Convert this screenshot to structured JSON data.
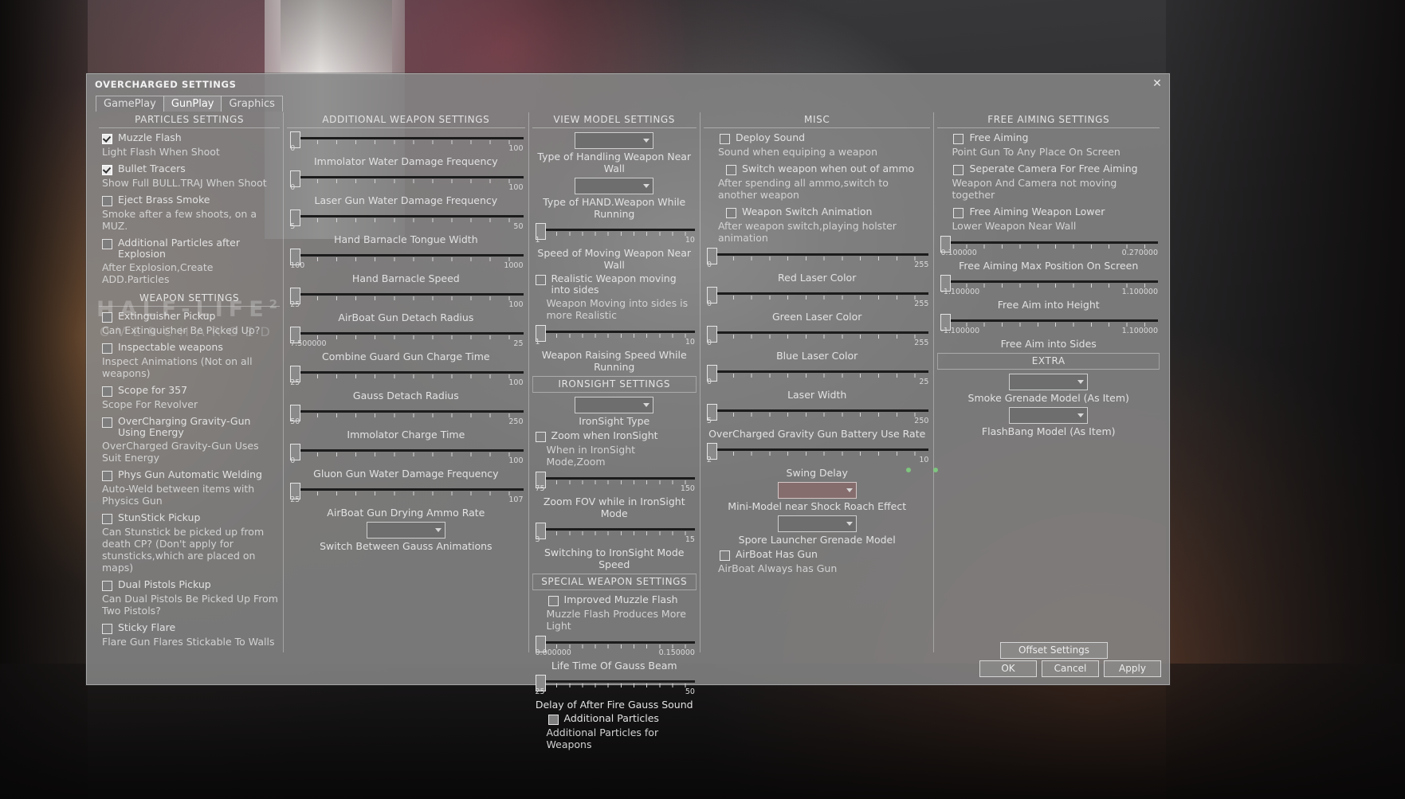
{
  "window": {
    "title": "OVERCHARGED SETTINGS",
    "close_icon": "close-icon"
  },
  "tabs": [
    {
      "label": "GamePlay",
      "active": false
    },
    {
      "label": "GunPlay",
      "active": true
    },
    {
      "label": "Graphics",
      "active": false
    }
  ],
  "watermark": {
    "line1": "HALF-LIFE",
    "sup": "2",
    "line2": "OVERCHARGED"
  },
  "columns": {
    "particles": {
      "header": "PARTICLES SETTINGS",
      "items": [
        {
          "label": "Muzzle Flash",
          "checked": true,
          "desc": "Light Flash When Shoot"
        },
        {
          "label": "Bullet Tracers",
          "checked": true,
          "desc": "Show Full BULL.TRAJ When Shoot"
        },
        {
          "label": "Eject Brass Smoke",
          "checked": false,
          "desc": "Smoke after a few shoots, on a MUZ."
        },
        {
          "label": "Additional Particles after Explosion",
          "checked": false,
          "desc": "After Explosion,Create ADD.Particles"
        }
      ],
      "header2": "WEAPON SETTINGS",
      "items2": [
        {
          "label": "Extinguisher Pickup",
          "checked": false,
          "desc": "Can Extinguisher Be Picked Up?"
        },
        {
          "label": "Inspectable weapons",
          "checked": false,
          "desc": "Inspect Animations (Not on all weapons)"
        },
        {
          "label": "Scope for 357",
          "checked": false,
          "desc": "Scope For Revolver"
        },
        {
          "label": "OverCharging Gravity-Gun Using Energy",
          "checked": false,
          "desc": "OverCharged Gravity-Gun Uses Suit Energy"
        },
        {
          "label": "Phys Gun Automatic Welding",
          "checked": false,
          "desc": "Auto-Weld between items with Physics Gun"
        },
        {
          "label": "StunStick Pickup",
          "checked": false,
          "desc": "Can Stunstick be picked up from death CP? (Don't apply for stunsticks,which are placed on maps)"
        },
        {
          "label": "Dual Pistols Pickup",
          "checked": false,
          "desc": "Can Dual Pistols Be Picked Up From Two Pistols?"
        },
        {
          "label": "Sticky Flare",
          "checked": false,
          "desc": "Flare Gun Flares Stickable To Walls"
        }
      ]
    },
    "additional_weapon": {
      "header": "ADDITIONAL WEAPON SETTINGS",
      "sliders": [
        {
          "label": "Immolator Water Damage Frequency",
          "min": "0",
          "max": "100",
          "pos": 0
        },
        {
          "label": "Laser Gun Water Damage Frequency",
          "min": "0",
          "max": "100",
          "pos": 0
        },
        {
          "label": "Hand Barnacle Tongue Width",
          "min": "5",
          "max": "50",
          "pos": 0
        },
        {
          "label": "Hand Barnacle Speed",
          "min": "100",
          "max": "1000",
          "pos": 0
        },
        {
          "label": "AirBoat Gun Detach Radius",
          "min": "25",
          "max": "100",
          "pos": 0
        },
        {
          "label": "Combine Guard Gun Charge Time",
          "min": "7.500000",
          "max": "25",
          "pos": 0
        },
        {
          "label": "Gauss Detach Radius",
          "min": "25",
          "max": "100",
          "pos": 0
        },
        {
          "label": "Immolator Charge Time",
          "min": "50",
          "max": "250",
          "pos": 0
        },
        {
          "label": "Gluon Gun Water Damage Frequency",
          "min": "0",
          "max": "100",
          "pos": 0
        },
        {
          "label": "AirBoat Gun Drying Ammo Rate",
          "min": "25",
          "max": "107",
          "pos": 0
        }
      ],
      "combo_label": "Switch Between Gauss Animations",
      "combo_value": ""
    },
    "view_model": {
      "header": "VIEW MODEL SETTINGS",
      "combo1_label": "Type of Handling Weapon Near Wall",
      "combo1_value": "",
      "combo2_label": "Type of HAND.Weapon While Running",
      "combo2_value": "",
      "slider1": {
        "label": "Speed of Moving Weapon Near Wall",
        "min": "1",
        "max": "10",
        "pos": 0
      },
      "check1": {
        "label": "Realistic Weapon moving into sides",
        "checked": false,
        "desc": "Weapon Moving into sides is more Realistic"
      },
      "slider2": {
        "label": "Weapon Raising Speed While Running",
        "min": "1",
        "max": "10",
        "pos": 0
      },
      "ironsight_header": "IRONSIGHT SETTINGS",
      "iron_combo_label": "IronSight Type",
      "iron_combo_value": "",
      "iron_check": {
        "label": "Zoom when IronSight",
        "checked": false,
        "desc": "When in IronSight Mode,Zoom"
      },
      "iron_slider1": {
        "label": "Zoom FOV while in IronSight Mode",
        "min": "75",
        "max": "150",
        "pos": 0
      },
      "iron_slider2": {
        "label": "Switching to IronSight Mode Speed",
        "min": "3",
        "max": "15",
        "pos": 0
      },
      "special_header": "SPECIAL WEAPON SETTINGS",
      "special_check1": {
        "label": "Improved Muzzle Flash",
        "checked": false,
        "desc": "Muzzle Flash Produces More Light"
      },
      "special_slider1": {
        "label": "Life Time Of Gauss Beam",
        "min": "0.000000",
        "max": "0.150000",
        "pos": 0
      },
      "special_slider2": {
        "label": "Delay of After Fire Gauss Sound",
        "min": "25",
        "max": "50",
        "pos": 0
      },
      "special_check2": {
        "label": "Additional Particles",
        "checked": false,
        "desc": "Additional Particles for Weapons"
      }
    },
    "misc": {
      "header": "MISC",
      "checks": [
        {
          "label": "Deploy Sound",
          "checked": false,
          "desc": "Sound when equiping a weapon",
          "indent": 0
        },
        {
          "label": "Switch weapon when out of ammo",
          "checked": false,
          "desc": "After spending all ammo,switch to another weapon",
          "indent": 1
        },
        {
          "label": "Weapon Switch Animation",
          "checked": false,
          "desc": "After weapon switch,playing holster animation",
          "indent": 1
        }
      ],
      "sliders": [
        {
          "label": "Red Laser Color",
          "min": "0",
          "max": "255",
          "pos": 0
        },
        {
          "label": "Green Laser Color",
          "min": "0",
          "max": "255",
          "pos": 0
        },
        {
          "label": "Blue Laser Color",
          "min": "0",
          "max": "255",
          "pos": 0
        },
        {
          "label": "Laser Width",
          "min": "0",
          "max": "25",
          "pos": 0
        },
        {
          "label": "OverCharged Gravity Gun Battery Use Rate",
          "min": "5",
          "max": "250",
          "pos": 0
        },
        {
          "label": "Swing Delay",
          "min": "2",
          "max": "10",
          "pos": 0
        }
      ],
      "combo1_label": "Mini-Model near Shock Roach Effect",
      "combo1_value": "",
      "combo2_label": "Spore Launcher Grenade Model",
      "combo2_value": "",
      "last_check": {
        "label": "AirBoat Has Gun",
        "checked": false,
        "desc": "AirBoat Always has Gun"
      }
    },
    "free_aiming": {
      "header": "FREE AIMING SETTINGS",
      "checks": [
        {
          "label": "Free Aiming",
          "checked": false,
          "desc": "Point Gun To Any Place On Screen"
        },
        {
          "label": "Seperate Camera For Free Aiming",
          "checked": false,
          "desc": "Weapon And Camera not moving together"
        },
        {
          "label": "Free Aiming Weapon Lower",
          "checked": false,
          "desc": "Lower Weapon Near Wall"
        }
      ],
      "sliders": [
        {
          "label": "Free Aiming Max Position On Screen",
          "min": "0.100000",
          "max": "0.270000",
          "pos": 0
        },
        {
          "label": "Free Aim into Height",
          "min": "-1.100000",
          "max": "1.100000",
          "pos": 0
        },
        {
          "label": "Free Aim into Sides",
          "min": "-1.100000",
          "max": "1.100000",
          "pos": 0
        }
      ],
      "extra_header": "EXTRA",
      "extra_combo1_label": "Smoke Grenade Model (As Item)",
      "extra_combo1_value": "",
      "extra_combo2_label": "FlashBang Model (As Item)",
      "extra_combo2_value": ""
    }
  },
  "footer": {
    "offset_settings": "Offset Settings",
    "ok": "OK",
    "cancel": "Cancel",
    "apply": "Apply"
  }
}
